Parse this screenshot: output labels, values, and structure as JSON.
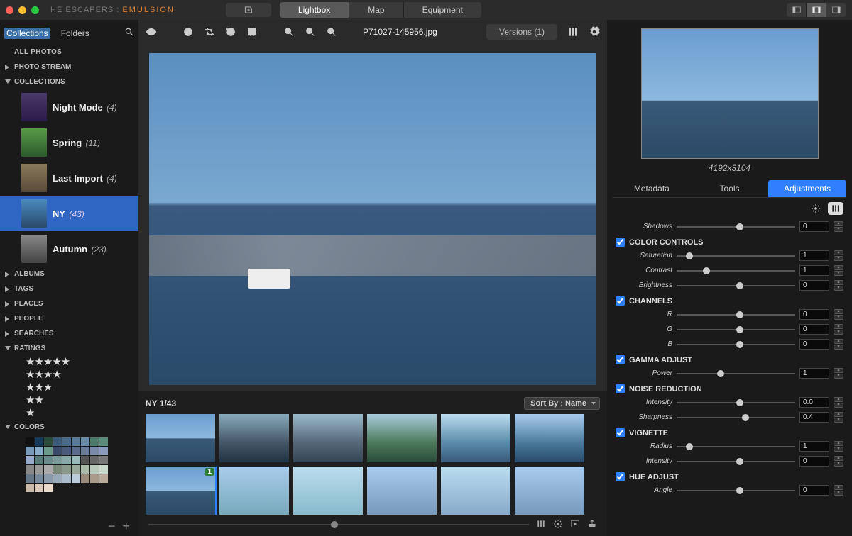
{
  "brand": {
    "pre": "HE ESCAPERS : ",
    "name": "EMULSION"
  },
  "topTabs": [
    "Lightbox",
    "Map",
    "Equipment"
  ],
  "topTabActive": 0,
  "sidebar": {
    "tabs": [
      "Collections",
      "Folders"
    ],
    "activeTab": 0,
    "allPhotos": "ALL PHOTOS",
    "photoStream": "PHOTO STREAM",
    "collectionsHead": "COLLECTIONS",
    "collections": [
      {
        "name": "Night Mode",
        "count": "(4)"
      },
      {
        "name": "Spring",
        "count": "(11)"
      },
      {
        "name": "Last Import",
        "count": "(4)"
      },
      {
        "name": "NY",
        "count": "(43)"
      },
      {
        "name": "Autumn",
        "count": "(23)"
      }
    ],
    "selectedCollection": 3,
    "sections": [
      "ALBUMS",
      "TAGS",
      "PLACES",
      "PEOPLE",
      "SEARCHES",
      "RATINGS"
    ],
    "colorsHead": "COLORS"
  },
  "toolbar": {
    "filename": "P71027-145956.jpg",
    "versions": "Versions (1)"
  },
  "filmstrip": {
    "title": "NY 1/43",
    "sort": "Sort By : Name",
    "selectedBadge": "1"
  },
  "right": {
    "dimensions": "4192x3104",
    "tabs": [
      "Metadata",
      "Tools",
      "Adjustments"
    ],
    "activeTab": 2,
    "shadows": {
      "label": "Shadows",
      "val": "0",
      "pos": 50
    },
    "colorControls": {
      "head": "COLOR CONTROLS",
      "items": [
        {
          "label": "Saturation",
          "val": "1",
          "pos": 8
        },
        {
          "label": "Contrast",
          "val": "1",
          "pos": 22
        },
        {
          "label": "Brightness",
          "val": "0",
          "pos": 50
        }
      ]
    },
    "channels": {
      "head": "CHANNELS",
      "items": [
        {
          "label": "R",
          "val": "0",
          "pos": 50
        },
        {
          "label": "G",
          "val": "0",
          "pos": 50
        },
        {
          "label": "B",
          "val": "0",
          "pos": 50
        }
      ]
    },
    "gamma": {
      "head": "GAMMA ADJUST",
      "items": [
        {
          "label": "Power",
          "val": "1",
          "pos": 34
        }
      ]
    },
    "noise": {
      "head": "NOISE REDUCTION",
      "items": [
        {
          "label": "Intensity",
          "val": "0.0",
          "pos": 50
        },
        {
          "label": "Sharpness",
          "val": "0.4",
          "pos": 55
        }
      ]
    },
    "vignette": {
      "head": "VIGNETTE",
      "items": [
        {
          "label": "Radius",
          "val": "1",
          "pos": 8
        },
        {
          "label": "Intensity",
          "val": "0",
          "pos": 50
        }
      ]
    },
    "hue": {
      "head": "HUE ADJUST",
      "items": [
        {
          "label": "Angle",
          "val": "0",
          "pos": 50
        }
      ]
    }
  }
}
